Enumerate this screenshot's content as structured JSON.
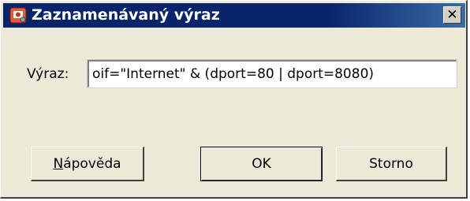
{
  "window": {
    "title": "Zaznamenávaný výraz",
    "close_symbol": "✕"
  },
  "field": {
    "label": "Výraz:",
    "value": "oif=\"Internet\" & (dport=80 | dport=8080)"
  },
  "buttons": {
    "help_first": "N",
    "help_rest": "ápověda",
    "ok": "OK",
    "cancel": "Storno"
  },
  "icons": {
    "app": "app-icon",
    "close": "close-icon"
  },
  "colors": {
    "titlebar": "#0a246a",
    "dialog_bg": "#ece9d8"
  }
}
